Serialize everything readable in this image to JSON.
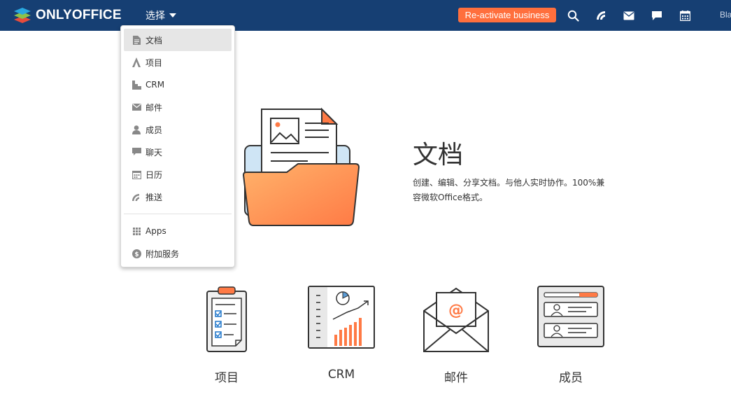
{
  "header": {
    "logo_text": "ONLYOFFICE",
    "select_label": "选择",
    "reactivate_label": "Re-activate business",
    "user_truncated": "Bla",
    "icons": [
      "search-icon",
      "feed-icon",
      "mail-icon",
      "chat-icon",
      "calendar-icon"
    ]
  },
  "dropdown": {
    "items": [
      {
        "label": "文档",
        "icon": "document-icon"
      },
      {
        "label": "项目",
        "icon": "projects-icon"
      },
      {
        "label": "CRM",
        "icon": "crm-icon"
      },
      {
        "label": "邮件",
        "icon": "mail-icon"
      },
      {
        "label": "成员",
        "icon": "people-icon"
      },
      {
        "label": "聊天",
        "icon": "chat-icon"
      },
      {
        "label": "日历",
        "icon": "calendar-icon"
      },
      {
        "label": "推送",
        "icon": "feed-icon"
      }
    ],
    "extra": [
      {
        "label": "Apps",
        "icon": "apps-icon"
      },
      {
        "label": "附加服务",
        "icon": "dollar-icon"
      }
    ]
  },
  "hero": {
    "title": "文档",
    "desc_line1": "创建、编辑、分享文档。与他人实时协作。100%兼",
    "desc_line2": "容微软Office格式。"
  },
  "modules": [
    {
      "label": "项目",
      "icon": "projects-clipboard-icon"
    },
    {
      "label": "CRM",
      "icon": "crm-chart-icon"
    },
    {
      "label": "邮件",
      "icon": "mail-envelope-icon"
    },
    {
      "label": "成员",
      "icon": "people-cards-icon"
    }
  ],
  "colors": {
    "header_bg": "#163f73",
    "accent": "#ff6f3d"
  }
}
